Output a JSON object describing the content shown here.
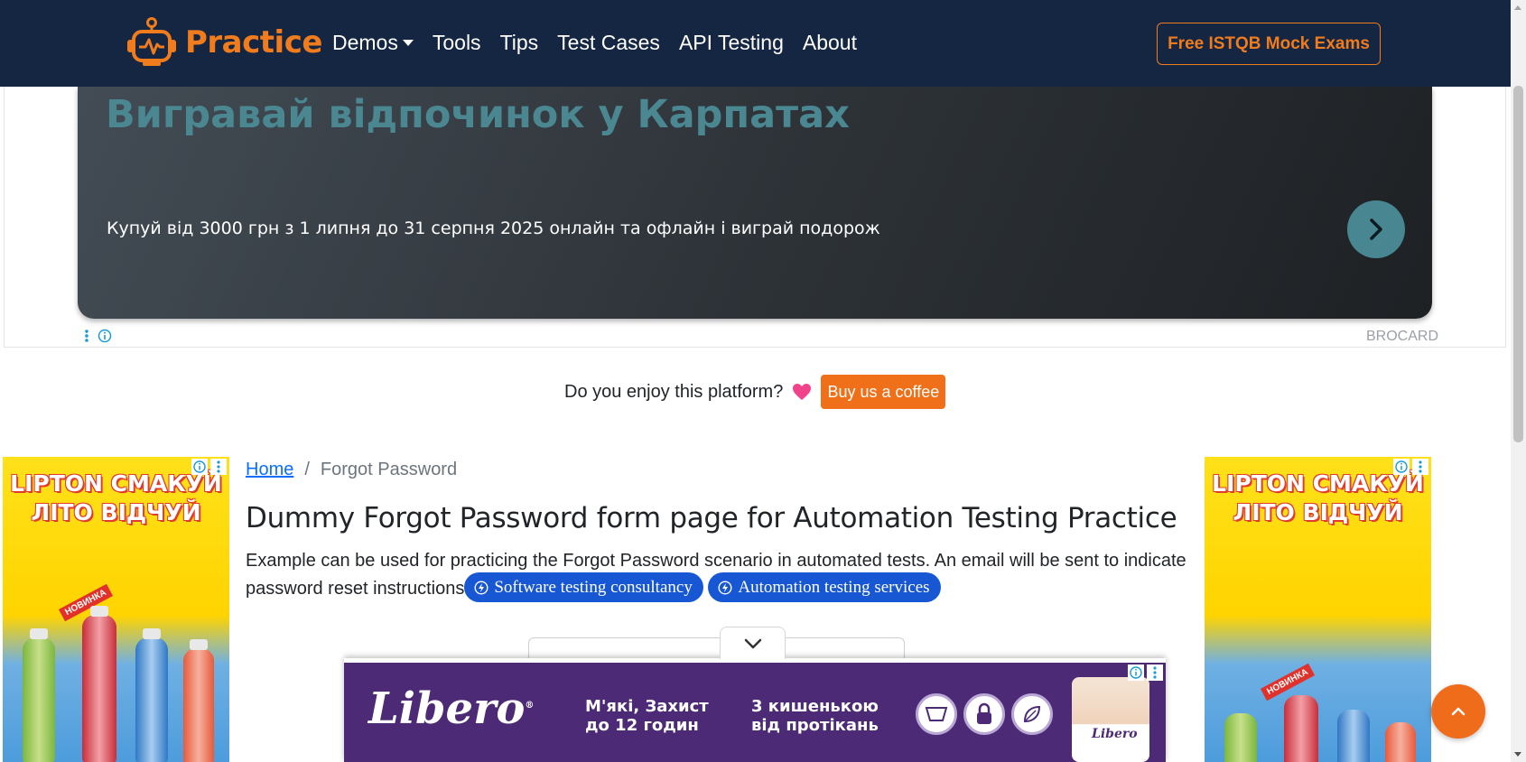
{
  "navbar": {
    "brand": "Practice",
    "links": [
      "Demos",
      "Tools",
      "Tips",
      "Test Cases",
      "API Testing",
      "About"
    ],
    "cta": "Free ISTQB Mock Exams"
  },
  "top_ad": {
    "heading": "Вигравай відпочинок у Карпатах",
    "subtext": "Купуй від 3000 грн з 1 липня до 31 серпня 2025 онлайн та офлайн і виграй подорож",
    "advertiser": "BROCARD"
  },
  "donate": {
    "text": "Do you enjoy this platform?",
    "button": "Buy us a coffee"
  },
  "side_ad": {
    "line1": "LIPTON СМАКУЙ",
    "line2": "ЛІТО ВІДЧУЙ",
    "tag": "НОВИНКА"
  },
  "breadcrumb": {
    "home": "Home",
    "separator": "/",
    "current": "Forgot Password"
  },
  "page": {
    "title": "Dummy Forgot Password form page for Automation Testing Practice",
    "description": "Example can be used for practicing the Forgot Password scenario in automated tests. An email will be sent to indicate password reset instructions",
    "pill1": "Software testing consultancy",
    "pill2": "Automation testing services"
  },
  "bottom_ad": {
    "logo": "Libero",
    "text1_line1": "М'які, Захист",
    "text1_line2": "до 12 годин",
    "text2_line1": "3 кишенькою",
    "text2_line2": "від протікань",
    "pack_brand": "Libero"
  },
  "colors": {
    "navbar_bg": "#152642",
    "brand_orange": "#f07c1d",
    "link_blue": "#0d6efd",
    "pill_blue": "#1757d4",
    "coffee_orange": "#ef7018",
    "ad_teal": "#4a8791",
    "libero_purple": "#4d2a76"
  },
  "icons": [
    "robot-logo-icon",
    "chevron-right-icon",
    "heart-icon",
    "bolt-circle-icon",
    "chevron-down-icon",
    "chevron-up-icon",
    "ad-info-icon",
    "ad-menu-icon"
  ]
}
